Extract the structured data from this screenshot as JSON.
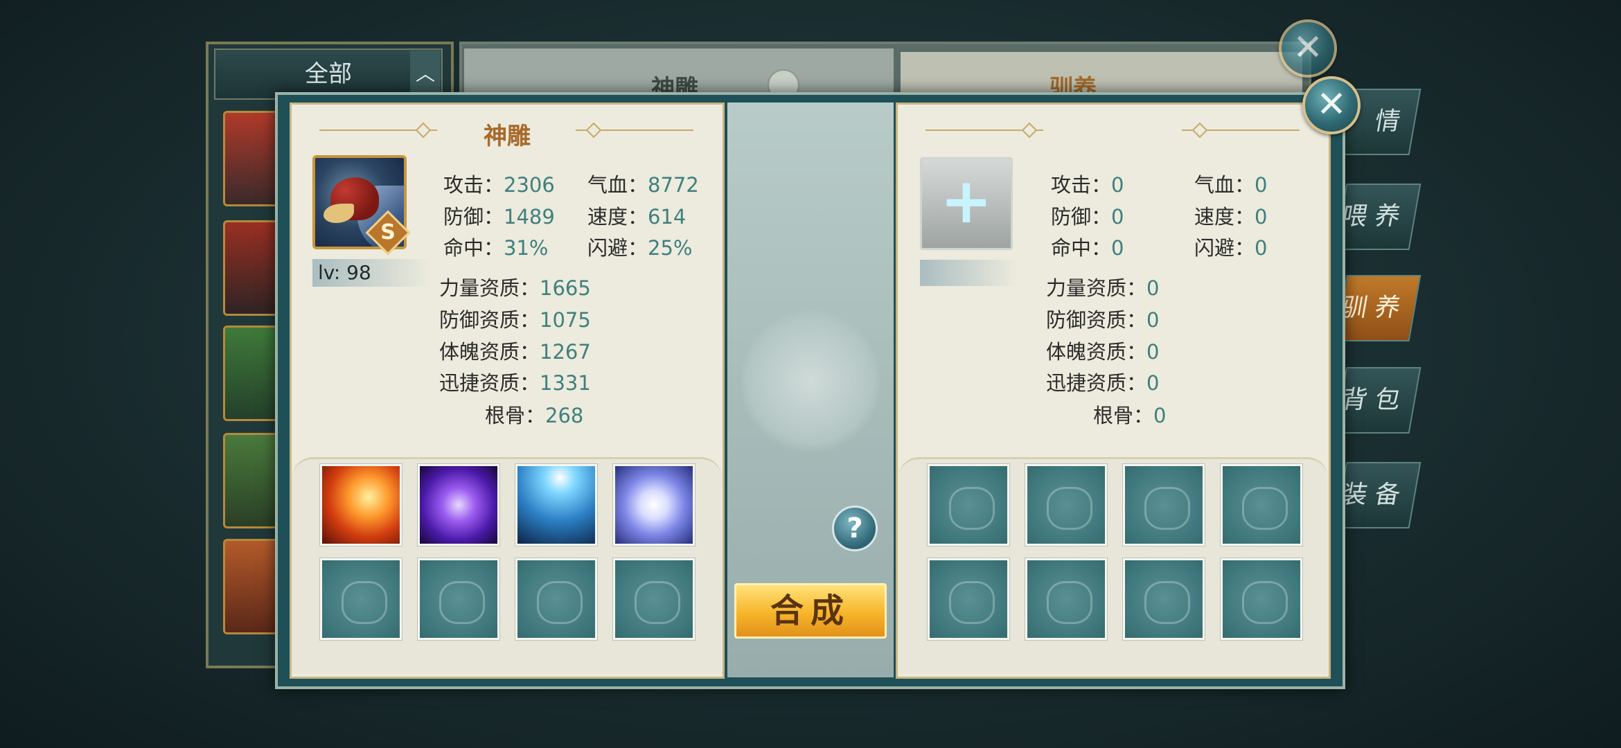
{
  "background": {
    "filter_label": "全部",
    "filter_arrow": "︿",
    "center_tab_title": "神雕",
    "right_tab_title": "驯养",
    "side_tabs": [
      "情",
      "喂 养",
      "驯 养",
      "背 包",
      "装 备"
    ]
  },
  "dialog": {
    "close_symbol": "✕",
    "left": {
      "title": "神雕",
      "grade": "S",
      "level": "lv: 98",
      "stats": [
        {
          "label": "攻击",
          "value": "2306"
        },
        {
          "label": "气血",
          "value": "8772"
        },
        {
          "label": "防御",
          "value": "1489"
        },
        {
          "label": "速度",
          "value": "614"
        },
        {
          "label": "命中",
          "value": "31%"
        },
        {
          "label": "闪避",
          "value": "25%"
        }
      ],
      "aptitudes": [
        {
          "label": "力量资质",
          "value": "1665"
        },
        {
          "label": "防御资质",
          "value": "1075"
        },
        {
          "label": "体魄资质",
          "value": "1267"
        },
        {
          "label": "迅捷资质",
          "value": "1331"
        },
        {
          "label": "根骨",
          "value": "268"
        }
      ],
      "skills": [
        "fire-phoenix-skill-icon",
        "purple-vortex-skill-icon",
        "lightning-skill-icon",
        "spirit-orb-skill-icon"
      ]
    },
    "right": {
      "add_symbol": "+",
      "stats": [
        {
          "label": "攻击",
          "value": "0"
        },
        {
          "label": "气血",
          "value": "0"
        },
        {
          "label": "防御",
          "value": "0"
        },
        {
          "label": "速度",
          "value": "0"
        },
        {
          "label": "命中",
          "value": "0"
        },
        {
          "label": "闪避",
          "value": "0"
        }
      ],
      "aptitudes": [
        {
          "label": "力量资质",
          "value": "0"
        },
        {
          "label": "防御资质",
          "value": "0"
        },
        {
          "label": "体魄资质",
          "value": "0"
        },
        {
          "label": "迅捷资质",
          "value": "0"
        },
        {
          "label": "根骨",
          "value": "0"
        }
      ]
    },
    "help_symbol": "?",
    "compose_label": "合成",
    "colors": {
      "accent_gold": "#a8692a",
      "value_teal": "#3f7f7d",
      "button_yellow": "#f7b52a"
    }
  }
}
